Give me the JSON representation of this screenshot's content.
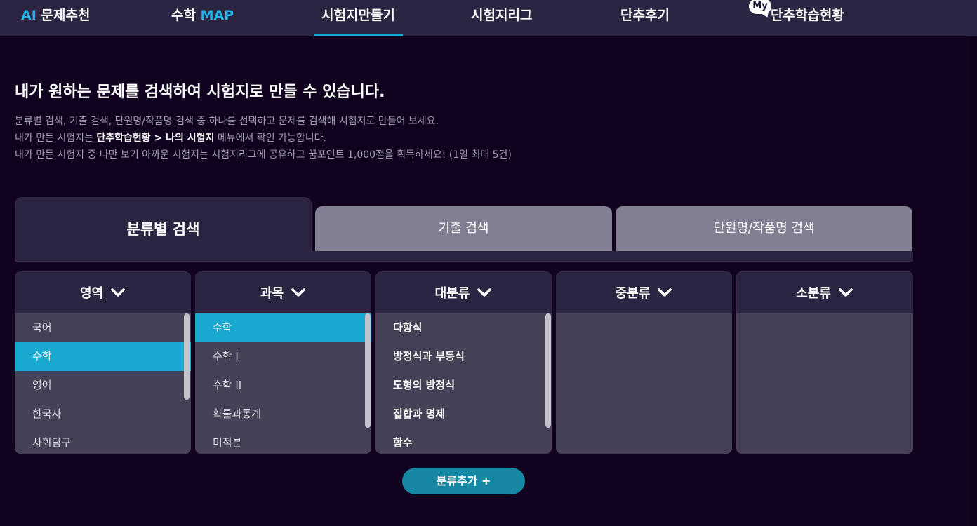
{
  "nav": {
    "ai_prefix": "AI",
    "ai_label": "문제추천",
    "math_label": "수학",
    "math_suffix": "MAP",
    "exam_make": "시험지만들기",
    "exam_league": "시험지리그",
    "review": "단추후기",
    "my_badge": "My",
    "status": "단추학습현황"
  },
  "intro": {
    "headline": "내가 원하는 문제를 검색하여 시험지로 만들 수 있습니다.",
    "line1": "분류별 검색, 기출 검색, 단원명/작품명 검색 중 하나를 선택하고 문제를 검색해 시험지로 만들어 보세요.",
    "line2_pre": "내가 만든 시험지는 ",
    "line2_bold": "단추학습현황 > 나의 시험지",
    "line2_post": " 메뉴에서 확인 가능합니다.",
    "line3": "내가 만든 시험지 중 나만 보기 아까운 시험지는 시험지리그에 공유하고 꿈포인트 1,000점을 획득하세요! (1일 최대 5건)"
  },
  "tabs": {
    "category": "분류별 검색",
    "past": "기출 검색",
    "unit": "단원명/작품명 검색"
  },
  "columns": {
    "area": {
      "title": "영역",
      "items": [
        "국어",
        "수학",
        "영어",
        "한국사",
        "사회탐구"
      ],
      "selected": "수학"
    },
    "subject": {
      "title": "과목",
      "items": [
        "수학",
        "수학 I",
        "수학 II",
        "확률과통계",
        "미적분"
      ],
      "selected": "수학"
    },
    "major": {
      "title": "대분류",
      "items": [
        "다항식",
        "방정식과 부등식",
        "도형의 방정식",
        "집합과 명제",
        "함수"
      ]
    },
    "middle": {
      "title": "중분류"
    },
    "minor": {
      "title": "소분류"
    }
  },
  "icons": {
    "chevron": "chevron-down-icon",
    "speech": "speech-bubble-icon"
  },
  "colors": {
    "accent": "#19a8cf",
    "nav_bg": "#2c2541",
    "page_bg": "#11031f",
    "button": "#1688a4"
  },
  "add_button": "분류추가 +"
}
